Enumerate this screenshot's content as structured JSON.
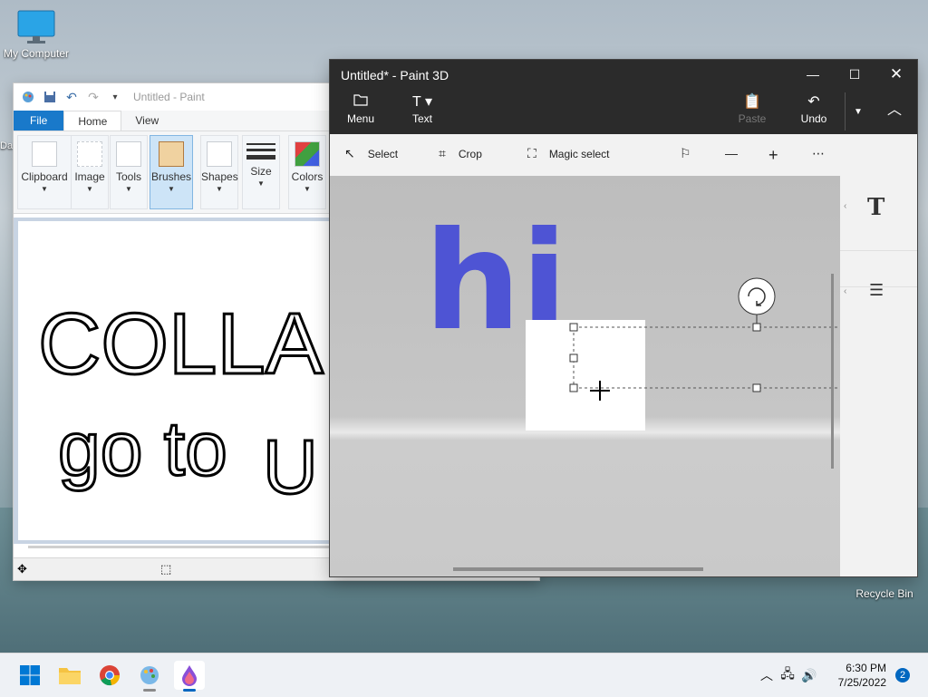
{
  "desktop": {
    "my_computer": "My Computer",
    "recycle_bin": "Recycle Bin",
    "partial_label": "Da"
  },
  "paint": {
    "title": "Untitled - Paint",
    "tabs": [
      "File",
      "Home",
      "View"
    ],
    "groups": [
      "Clipboard",
      "Image",
      "Tools",
      "Brushes",
      "Shapes",
      "Size",
      "Colors"
    ],
    "selected_group": "Brushes",
    "canvas_text_line1": "COLLAB",
    "canvas_text_line2": "go to",
    "canvas_text_line2_tail": "U"
  },
  "paint3d": {
    "title": "Untitled* - Paint 3D",
    "commands": {
      "menu": "Menu",
      "text": "Text",
      "paste": "Paste",
      "undo": "Undo"
    },
    "tools": {
      "select": "Select",
      "crop": "Crop",
      "magic_select": "Magic select"
    },
    "object_text": "hi",
    "right_panel_icon": "T"
  },
  "taskbar": {
    "time": "6:30 PM",
    "date": "7/25/2022",
    "notifications": "2"
  },
  "colors": {
    "p3d_dark": "#2b2b2b",
    "paint_file_tab": "#1979ca",
    "hi_blue": "#4e54d4",
    "windows_blue": "#0067c0"
  }
}
